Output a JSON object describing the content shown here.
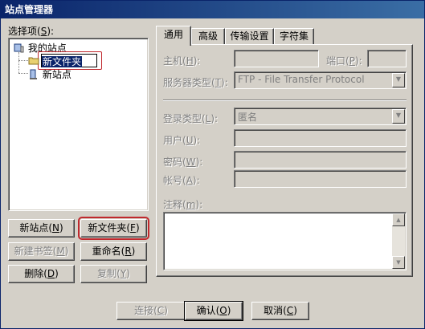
{
  "window": {
    "title": "站点管理器"
  },
  "left": {
    "select_label": "选择项(",
    "select_key": "S",
    "select_label_end": "):",
    "tree": {
      "root": "我的站点",
      "editing_item": "新文件夹",
      "site_item": "新站点"
    },
    "buttons": {
      "new_site": {
        "text": "新站点(",
        "key": "N",
        "end": ")"
      },
      "new_folder": {
        "text": "新文件夹(",
        "key": "F",
        "end": ")"
      },
      "new_bookmark": {
        "text": "新建书签(",
        "key": "M",
        "end": ")"
      },
      "rename": {
        "text": "重命名(",
        "key": "R",
        "end": ")"
      },
      "delete": {
        "text": "删除(",
        "key": "D",
        "end": ")"
      },
      "copy": {
        "text": "复制(",
        "key": "Y",
        "end": ")"
      }
    }
  },
  "tabs": [
    {
      "label": "通用"
    },
    {
      "label": "高级"
    },
    {
      "label": "传输设置"
    },
    {
      "label": "字符集"
    }
  ],
  "general": {
    "host": {
      "text": "主机(",
      "key": "H",
      "end": "):"
    },
    "port": {
      "text": "端口(",
      "key": "P",
      "end": "):"
    },
    "server_type": {
      "text": "服务器类型(",
      "key": "T",
      "end": "):",
      "value": "FTP - File Transfer Protocol"
    },
    "login_type": {
      "text": "登录类型(",
      "key": "L",
      "end": "):",
      "value": "匿名"
    },
    "user": {
      "text": "用户(",
      "key": "U",
      "end": "):"
    },
    "password": {
      "text": "密码(",
      "key": "W",
      "end": "):"
    },
    "account": {
      "text": "帐号(",
      "key": "A",
      "end": "):"
    },
    "comments": {
      "text": "注释(",
      "key": "m",
      "end": "):"
    }
  },
  "footer": {
    "connect": {
      "text": "连接(",
      "key": "C",
      "end": ")"
    },
    "ok": {
      "text": "确认(",
      "key": "O",
      "end": ")"
    },
    "cancel": {
      "text": "取消(",
      "key": "C",
      "end": ")"
    }
  },
  "colors": {
    "title_bar": "#0a246a",
    "highlight_ring": "#c0282d",
    "face": "#d4d0c8"
  }
}
